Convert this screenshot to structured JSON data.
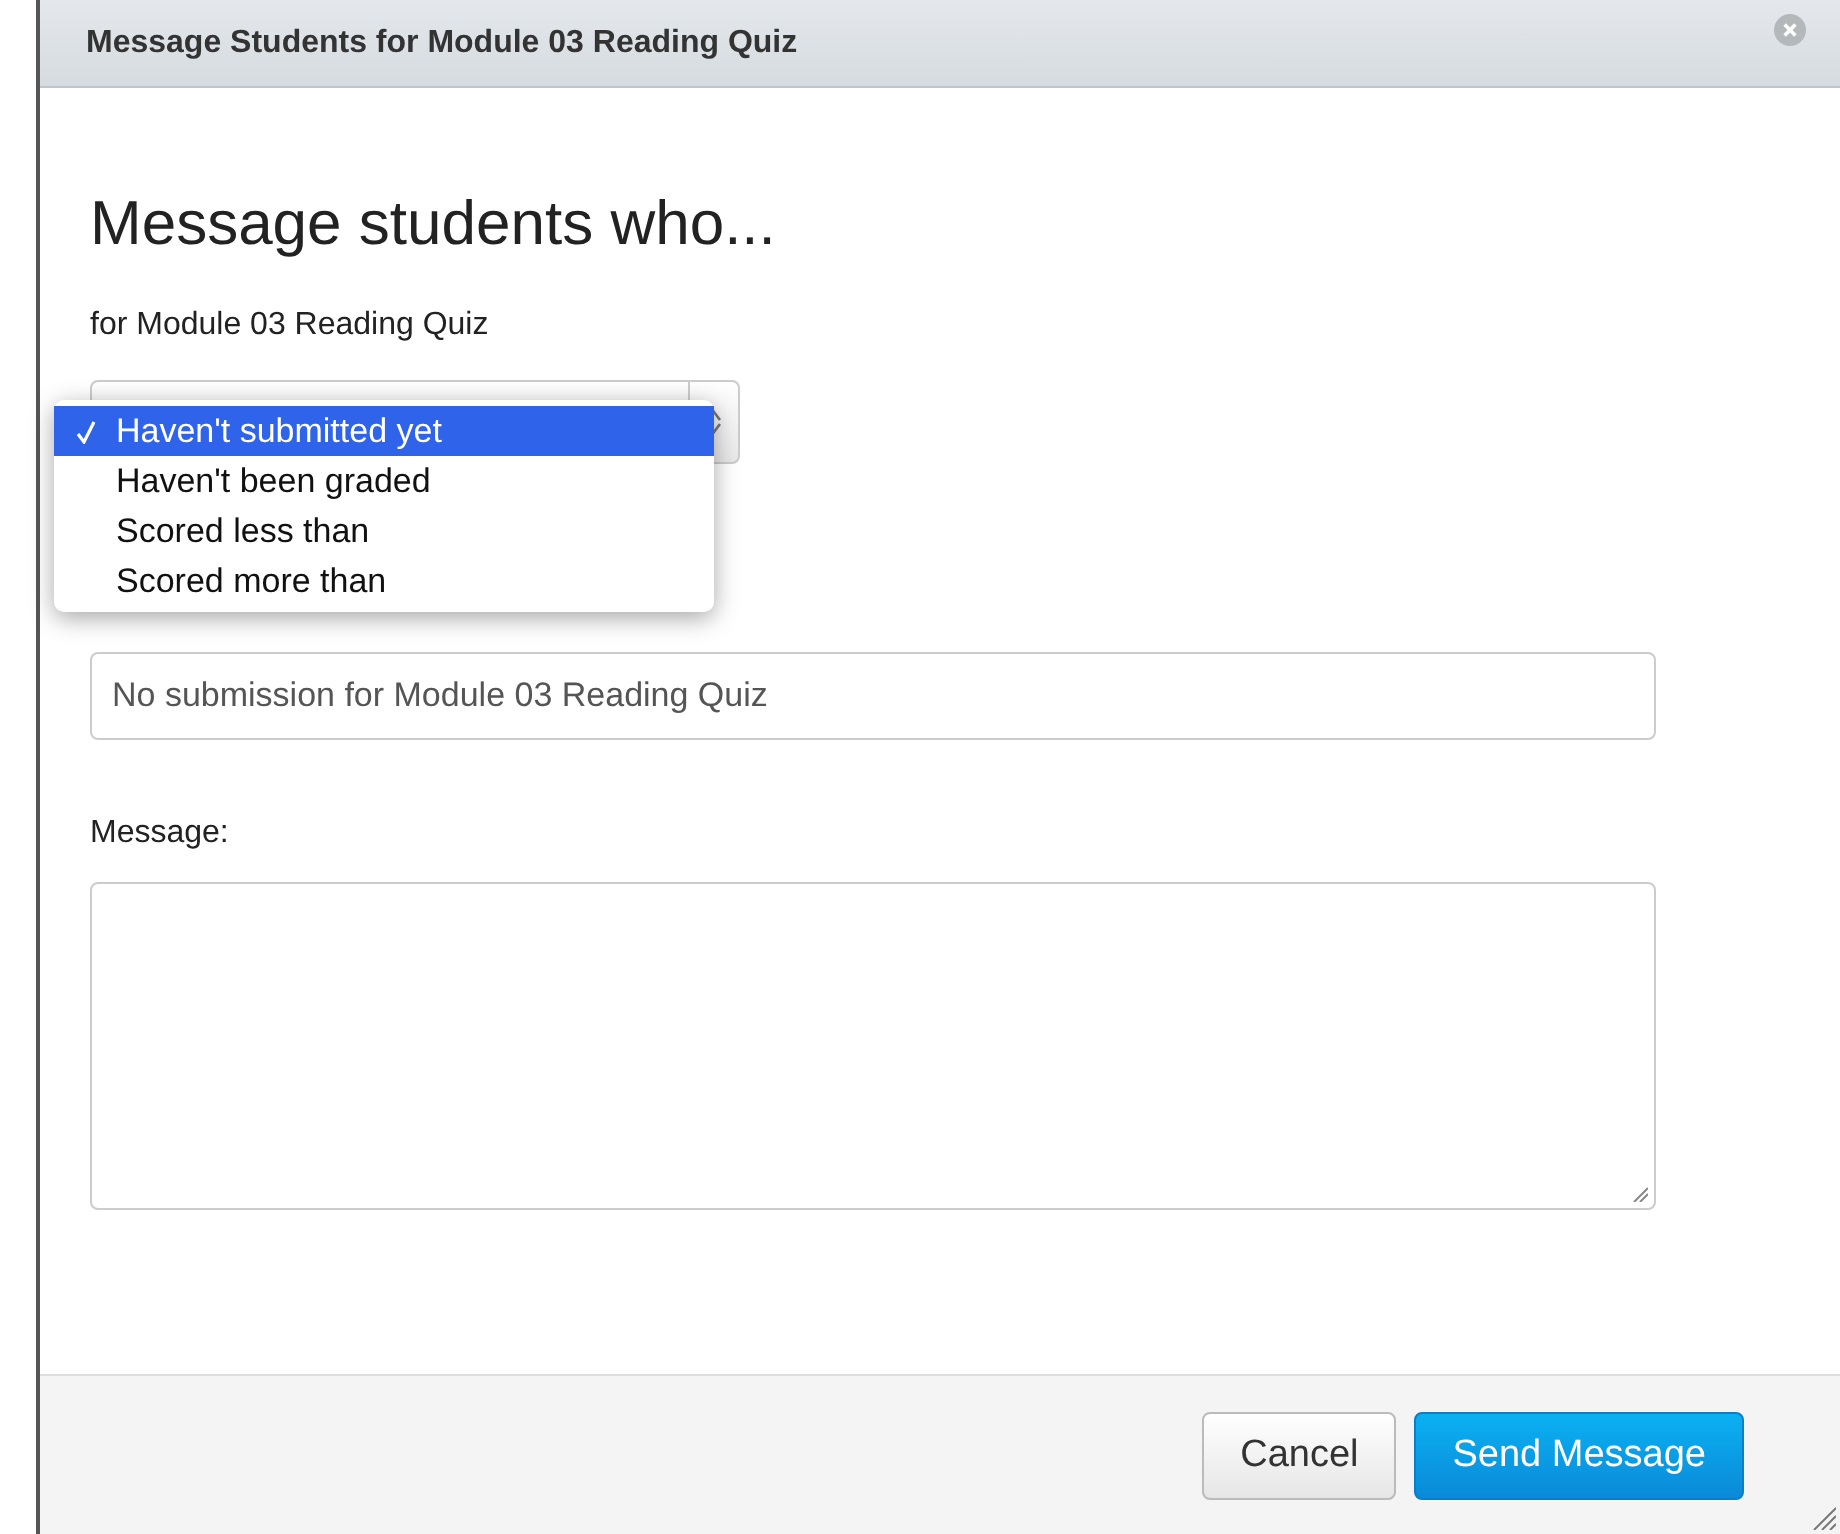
{
  "dialog": {
    "title": "Message Students for Module 03 Reading Quiz"
  },
  "heading": "Message students who...",
  "subtitle": "for Module 03 Reading Quiz",
  "criteria_menu": [
    {
      "label": "Haven't submitted yet",
      "selected": true
    },
    {
      "label": "Haven't been graded",
      "selected": false
    },
    {
      "label": "Scored less than",
      "selected": false
    },
    {
      "label": "Scored more than",
      "selected": false
    }
  ],
  "subject": {
    "value": "No submission for Module 03 Reading Quiz"
  },
  "message": {
    "label": "Message:"
  },
  "buttons": [
    {
      "label": "Cancel",
      "kind": "secondary"
    },
    {
      "label": "Send Message",
      "kind": "primary"
    }
  ]
}
